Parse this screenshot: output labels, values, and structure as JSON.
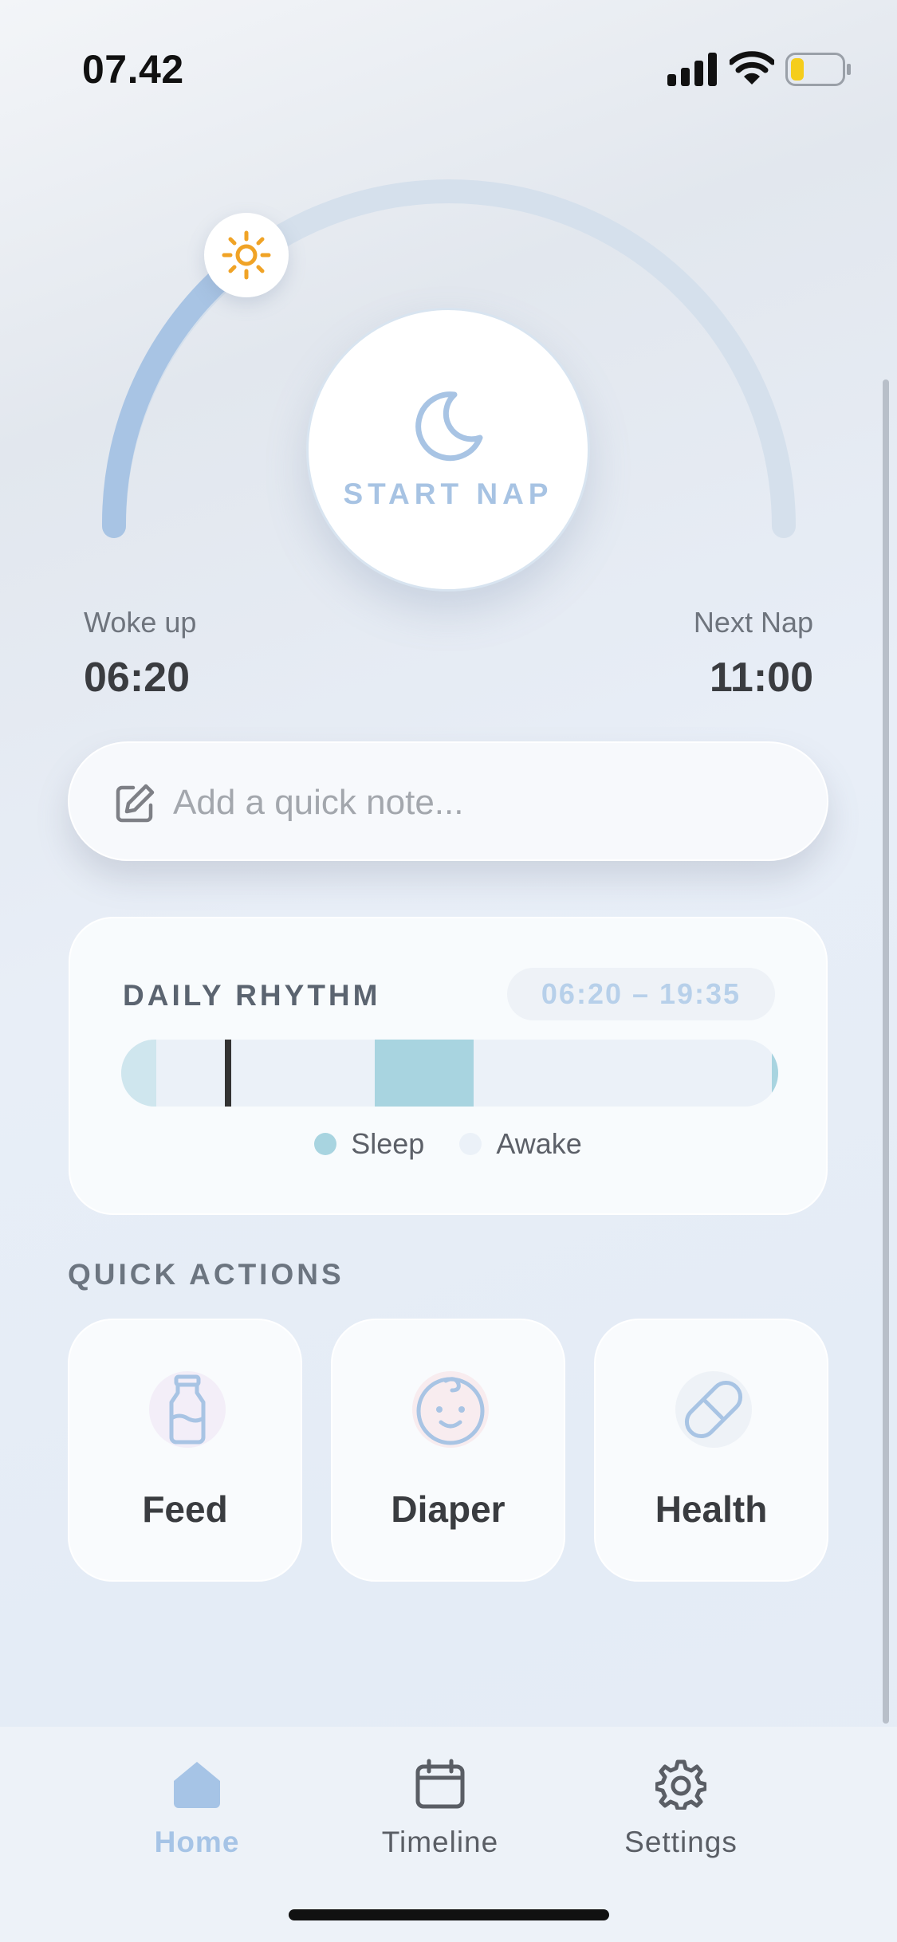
{
  "status_bar": {
    "time": "07.42",
    "battery_level": 0.25
  },
  "hero": {
    "start_label": "START NAP",
    "woke_caption": "Woke up",
    "woke_time": "06:20",
    "next_caption": "Next Nap",
    "next_time": "11:00"
  },
  "note": {
    "placeholder": "Add a quick note..."
  },
  "rhythm": {
    "title": "DAILY RHYTHM",
    "range": "06:20 – 19:35",
    "legend_sleep": "Sleep",
    "legend_awake": "Awake"
  },
  "quick_actions": {
    "heading": "QUICK ACTIONS",
    "items": [
      {
        "label": "Feed",
        "icon": "bottle-icon"
      },
      {
        "label": "Diaper",
        "icon": "baby-face-icon"
      },
      {
        "label": "Health",
        "icon": "pill-icon"
      }
    ]
  },
  "tabs": [
    {
      "label": "Home",
      "icon": "home-icon",
      "active": true
    },
    {
      "label": "Timeline",
      "icon": "calendar-icon",
      "active": false
    },
    {
      "label": "Settings",
      "icon": "gear-icon",
      "active": false
    }
  ],
  "colors": {
    "accent": "#a6c4e6",
    "sleep": "#a8d4e0",
    "awake": "#ebf1f8",
    "sun": "#f0a326",
    "feed_bg": "#f3eef8",
    "diaper_bg": "#f8ecef",
    "health_bg": "#eef2f7"
  }
}
